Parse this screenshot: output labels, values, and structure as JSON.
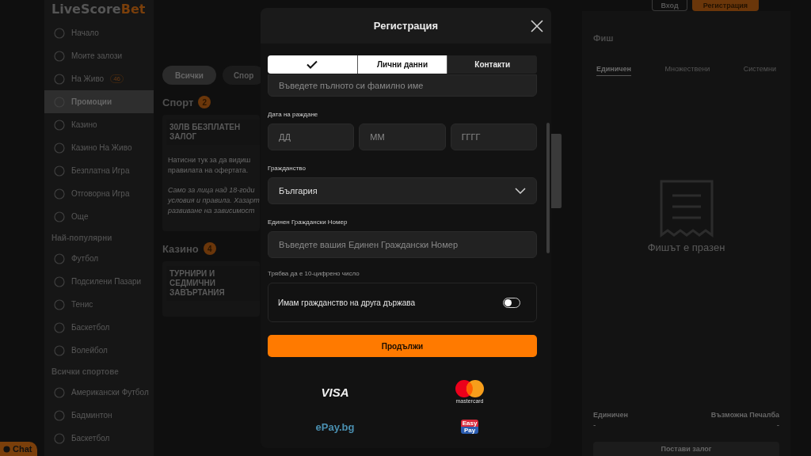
{
  "sidebar": {
    "logo": {
      "text_1": "LiveScore",
      "text_2": "Bet"
    },
    "items": [
      {
        "label": "Начало",
        "selected": false
      },
      {
        "label": "Моите залози",
        "selected": false
      },
      {
        "label": "На Живо",
        "selected": false,
        "badge": "46"
      },
      {
        "label": "Промоции",
        "selected": true
      },
      {
        "label": "Казино",
        "selected": false
      },
      {
        "label": "Казино На Живо",
        "selected": false
      },
      {
        "label": "Безплатна Игра",
        "selected": false
      },
      {
        "label": "Отговорна Игра",
        "selected": false
      },
      {
        "label": "Още",
        "selected": false
      }
    ],
    "sections": [
      {
        "title": "Най-популярни",
        "items": [
          {
            "label": "Футбол",
            "selected": false
          },
          {
            "label": "Подсилени Пазари",
            "selected": false
          },
          {
            "label": "Тенис",
            "selected": false
          },
          {
            "label": "Баскетбол",
            "selected": false
          },
          {
            "label": "Волейбол",
            "selected": false
          }
        ]
      },
      {
        "title": "Всички спортове",
        "items": [
          {
            "label": "Американски Футбол",
            "selected": false
          },
          {
            "label": "Бадминтон",
            "selected": false
          },
          {
            "label": "Баскетбол",
            "selected": false
          }
        ]
      }
    ]
  },
  "chat_button": {
    "label": "Chat"
  },
  "header": {
    "buttons": [
      {
        "label": "Вход",
        "kind": "outline"
      },
      {
        "label": "Регистрация",
        "kind": "primary"
      }
    ]
  },
  "promotions": {
    "filters": [
      {
        "label": "Всички",
        "selected": true
      },
      {
        "label": "Спор",
        "selected": false
      }
    ],
    "sections": [
      {
        "title": "Спорт",
        "count": "2",
        "card": {
          "title": "30ЛВ БЕЗПЛАТЕН ЗАЛОГ",
          "lines": [
            "Натисни тук за да видиш",
            "правилата на офертата."
          ],
          "note_lines": [
            "Само за лица над 18-годи",
            "условия и правила. Хазарт",
            "развиване на зависимост"
          ]
        }
      },
      {
        "title": "Казино",
        "count": "4",
        "card": {
          "title": "ТУРНИРИ И СЕДМИЧНИ ЗАВЪРТАНИЯ"
        }
      }
    ]
  },
  "bet_slip": {
    "title": "Фиш",
    "tabs": [
      {
        "label": "Единичен",
        "selected": true
      },
      {
        "label": "Множествени",
        "selected": false
      },
      {
        "label": "Системни",
        "selected": false
      }
    ],
    "empty_text": "Фишът е празен",
    "summary": [
      {
        "label": "Единичен",
        "value": "-"
      },
      {
        "label": "Възможна Печалба",
        "value": "-"
      }
    ],
    "place_bet": "Постави залог"
  },
  "modal": {
    "title": "Регистрация",
    "steps": [
      {
        "kind": "check",
        "active": true
      },
      {
        "kind": "text",
        "label": "Лични данни",
        "active": true
      },
      {
        "kind": "text",
        "label": "Контакти",
        "active": false
      }
    ],
    "surname_field": {
      "placeholder": "Въведете пълното си фамилно име"
    },
    "birth_date": {
      "label": "Дата на раждане",
      "fields": [
        {
          "placeholder": "ДД"
        },
        {
          "placeholder": "ММ"
        },
        {
          "placeholder": "ГГГГ"
        }
      ]
    },
    "citizenship": {
      "label": "Гражданство",
      "value": "България"
    },
    "egn": {
      "label": "Единен Граждански Номер",
      "placeholder": "Въведете вашия Единен Граждански Номер",
      "hint": "Трябва да е 10-цифрено число"
    },
    "dual_citizenship": {
      "label": "Имам гражданство на друга държава",
      "on": false
    },
    "continue_button": "Продължи",
    "payments": [
      {
        "kind": "visa",
        "text": "VISA"
      },
      {
        "kind": "mastercard",
        "text": "mastercard"
      },
      {
        "kind": "epay",
        "text": "ePay.bg"
      },
      {
        "kind": "easypay",
        "text_1": "Easy",
        "text_2": "Pay"
      }
    ]
  }
}
